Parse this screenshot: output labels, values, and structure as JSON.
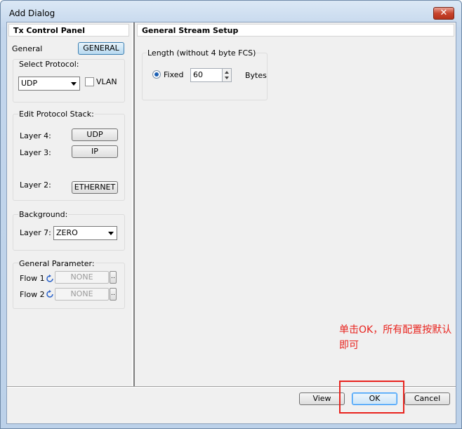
{
  "window": {
    "title": "Add Dialog",
    "close_label": "✕"
  },
  "left_panel": {
    "header": "Tx Control Panel",
    "general_label": "General",
    "general_button": "GENERAL",
    "select_protocol": {
      "label": "Select Protocol:",
      "value": "UDP",
      "vlan_label": "VLAN",
      "vlan_checked": false
    },
    "protocol_stack": {
      "label": "Edit Protocol Stack:",
      "layers": [
        {
          "label": "Layer 4:",
          "button": "UDP"
        },
        {
          "label": "Layer 3:",
          "button": "IP"
        },
        {
          "label": "Layer 2:",
          "button": "ETHERNET"
        }
      ]
    },
    "background": {
      "label": "Background:",
      "layer_label": "Layer 7:",
      "value": "ZERO"
    },
    "general_parameter": {
      "label": "General Parameter:",
      "flows": [
        {
          "label": "Flow 1",
          "value": "NONE",
          "more": ".."
        },
        {
          "label": "Flow 2",
          "value": "NONE",
          "more": ".."
        }
      ]
    }
  },
  "right_panel": {
    "header": "General Stream Setup",
    "length_group_label": "Length (without 4 byte FCS)",
    "fixed_label": "Fixed",
    "length_value": "60",
    "unit_label": "Bytes"
  },
  "footer": {
    "view_label": "View",
    "ok_label": "OK",
    "cancel_label": "Cancel"
  },
  "annotation": {
    "text": "单击OK，所有配置按默认即可",
    "color": "#e8231e"
  },
  "colors": {
    "accent": "#3399ff",
    "annotation": "#e8231e"
  }
}
